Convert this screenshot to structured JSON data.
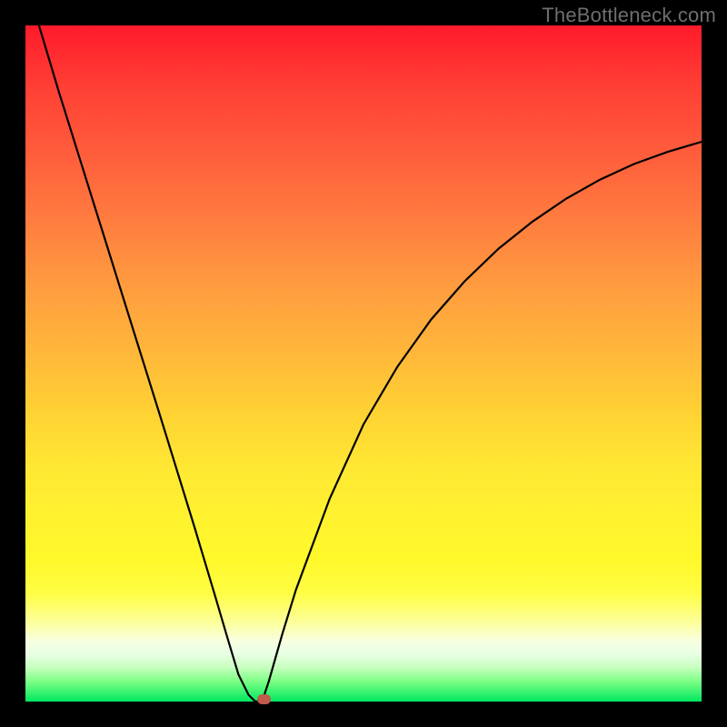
{
  "watermark": "TheBottleneck.com",
  "chart_data": {
    "type": "line",
    "title": "",
    "xlabel": "",
    "ylabel": "",
    "xlim": [
      0,
      100
    ],
    "ylim": [
      0,
      100
    ],
    "grid": false,
    "legend": false,
    "series": [
      {
        "name": "left-branch",
        "x": [
          2,
          5,
          10,
          15,
          20,
          25,
          28,
          30,
          31.5,
          33,
          34
        ],
        "values": [
          100,
          90,
          74,
          58,
          42,
          25.8,
          15.8,
          9,
          4,
          1,
          0
        ]
      },
      {
        "name": "right-branch",
        "x": [
          35,
          36,
          38,
          40,
          45,
          50,
          55,
          60,
          65,
          70,
          75,
          80,
          85,
          90,
          95,
          100
        ],
        "values": [
          0,
          3,
          10,
          16.5,
          30,
          41,
          49.5,
          56.5,
          62.2,
          67,
          71,
          74.4,
          77.2,
          79.5,
          81.3,
          82.8
        ]
      }
    ],
    "annotations": [
      {
        "name": "minimum-marker",
        "x": 35.3,
        "y": 0.3
      }
    ],
    "colors": {
      "gradient_top": "#ff1a2a",
      "gradient_bottom": "#00e85f",
      "curve": "#000000",
      "marker": "#c05a4a"
    }
  }
}
